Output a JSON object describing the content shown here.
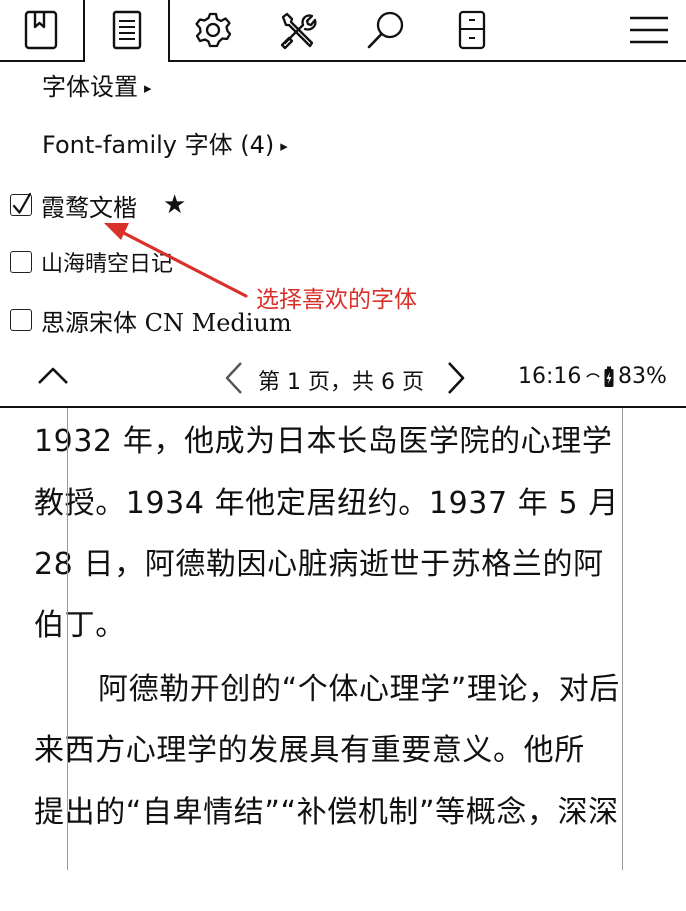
{
  "toolbar": {
    "items": [
      {
        "icon": "bookmark-page-icon"
      },
      {
        "icon": "toc-list-icon",
        "active": true
      },
      {
        "icon": "gear-icon"
      },
      {
        "icon": "tools-icon"
      },
      {
        "icon": "search-icon"
      },
      {
        "icon": "device-icon"
      },
      {
        "icon": "hamburger-menu-icon"
      }
    ]
  },
  "menu": {
    "font_settings": "字体设置",
    "font_family": "Font-family 字体 (4)",
    "submenu_arrow": "▸",
    "fonts": [
      {
        "label": "霞鹜文楷",
        "checked": true,
        "check_mark": "✓",
        "starred": true,
        "star": "★"
      },
      {
        "label": "山海晴空日记",
        "checked": false
      },
      {
        "label": "思源宋体 CN Medium",
        "checked": false
      }
    ]
  },
  "annotation": {
    "text": "选择喜欢的字体",
    "color": "#d9302a"
  },
  "status": {
    "page_text": "第 1 页，共 6 页",
    "time": "16:16",
    "battery": "83%"
  },
  "content": {
    "lines": [
      "1932 年，他成为日本长岛医学院的心理学",
      "教授。1934 年他定居纽约。1937 年 5 月",
      "28 日，阿德勒因心脏病逝世于苏格兰的阿",
      "伯丁。",
      "阿德勒开创的“个体心理学”理论，对后",
      "来西方心理学的发展具有重要意义。他所",
      "提出的“自卑情结”“补偿机制”等概念，深深"
    ]
  }
}
